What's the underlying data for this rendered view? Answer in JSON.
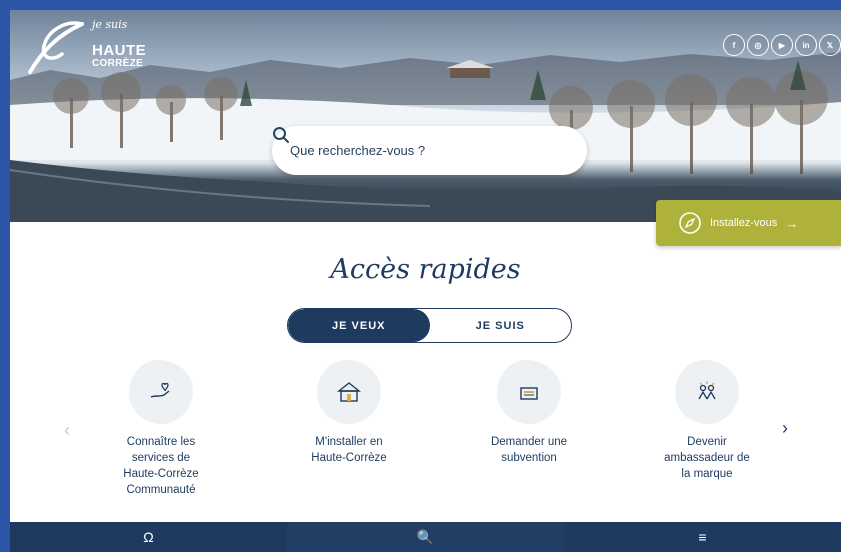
{
  "brand": {
    "tagline": "je suis",
    "name_line1": "HAUTE",
    "name_line2": "CORRÈZE"
  },
  "socials": [
    {
      "icon": "facebook-icon",
      "glyph": "f"
    },
    {
      "icon": "instagram-icon",
      "glyph": "◎"
    },
    {
      "icon": "youtube-icon",
      "glyph": "▶"
    },
    {
      "icon": "linkedin-icon",
      "glyph": "in"
    },
    {
      "icon": "x-icon",
      "glyph": "𝕏"
    }
  ],
  "search": {
    "placeholder": "Que recherchez-vous ?"
  },
  "install": {
    "label": "Installez-vous",
    "arrow": "→"
  },
  "quick_access": {
    "title": "Accès rapides",
    "tabs": [
      "JE VEUX",
      "JE SUIS"
    ],
    "active_tab": "JE VEUX",
    "cards": [
      {
        "line1": "Connaître les",
        "line2": "services de",
        "line3": "Haute-Corrèze",
        "line4": "Communauté",
        "icon": "hand-heart-icon"
      },
      {
        "line1": "M'installer en",
        "line2": "Haute-Corrèze",
        "line3": "",
        "line4": "",
        "icon": "house-icon"
      },
      {
        "line1": "Demander une",
        "line2": "subvention",
        "line3": "",
        "line4": "",
        "icon": "money-icon"
      },
      {
        "line1": "Devenir",
        "line2": "ambassadeur de",
        "line3": "la marque",
        "line4": "",
        "icon": "people-celebrate-icon"
      }
    ],
    "prev": "‹",
    "next": "›"
  },
  "bottom_bar": {
    "user": "Ω",
    "search": "🔍",
    "menu": "≡"
  },
  "colors": {
    "navy": "#1e3a5f",
    "olive": "#afb23a",
    "frame_blue": "#2c55a8"
  }
}
